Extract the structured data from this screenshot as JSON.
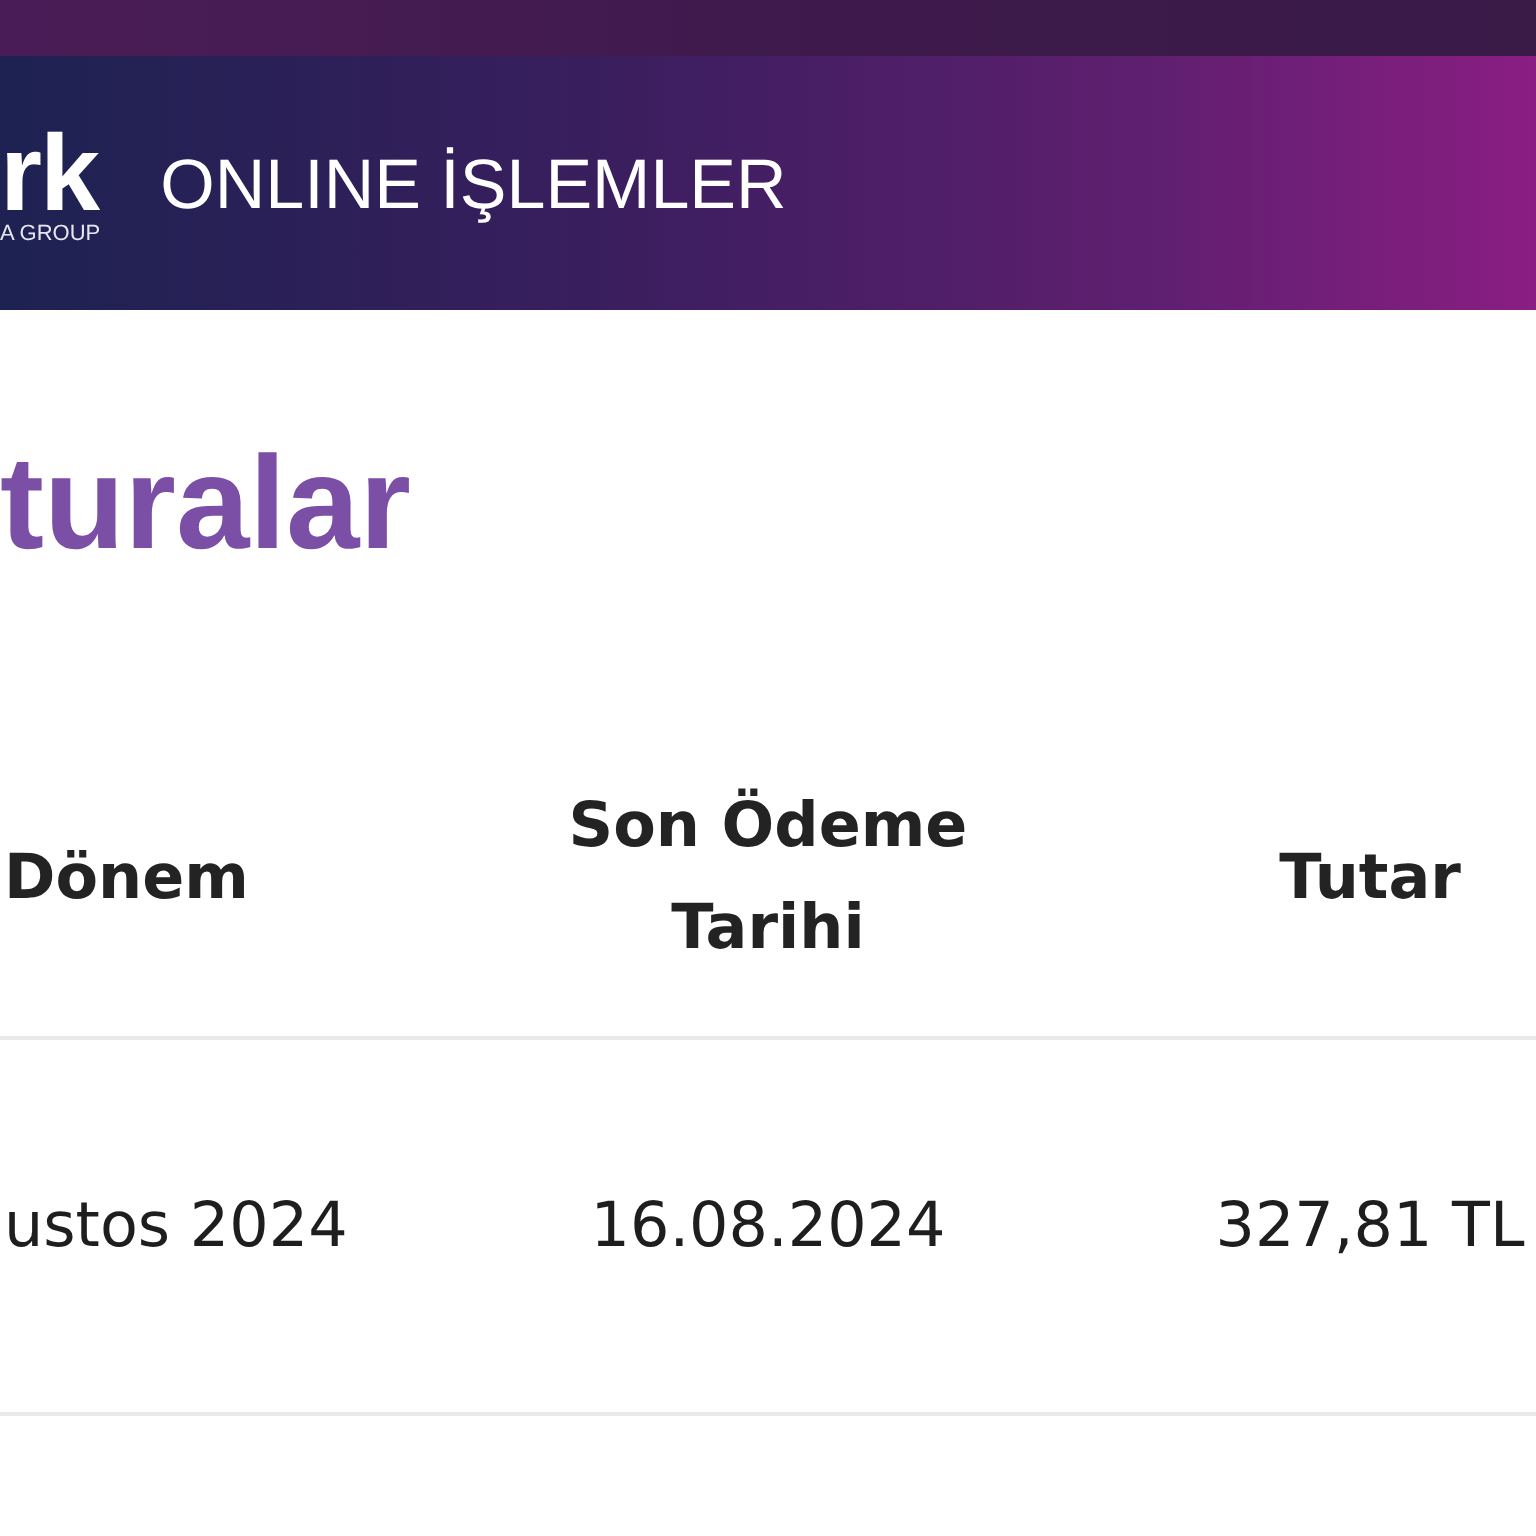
{
  "header": {
    "logo": {
      "wordmark": "rk",
      "tagline": "A GROUP"
    },
    "title": "ONLINE İŞLEMLER"
  },
  "page_title": "turalar",
  "table": {
    "columns": [
      "Dönem",
      "Son Ödeme Tarihi",
      "Tutar"
    ],
    "rows": [
      [
        "ustos 2024",
        "16.08.2024",
        "327,81 TL"
      ]
    ]
  }
}
